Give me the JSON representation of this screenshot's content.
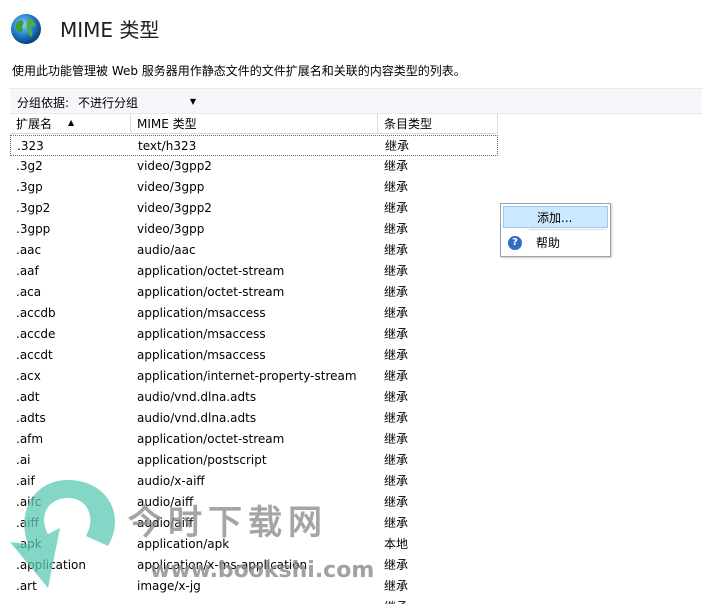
{
  "header": {
    "title": "MIME 类型",
    "description": "使用此功能管理被 Web 服务器用作静态文件的文件扩展名和关联的内容类型的列表。"
  },
  "toolbar": {
    "group_label": "分组依据:",
    "group_value": "不进行分组"
  },
  "columns": {
    "ext": "扩展名",
    "mime": "MIME 类型",
    "type": "条目类型"
  },
  "rows": [
    {
      "ext": ".323",
      "mime": "text/h323",
      "type": "继承"
    },
    {
      "ext": ".3g2",
      "mime": "video/3gpp2",
      "type": "继承"
    },
    {
      "ext": ".3gp",
      "mime": "video/3gpp",
      "type": "继承"
    },
    {
      "ext": ".3gp2",
      "mime": "video/3gpp2",
      "type": "继承"
    },
    {
      "ext": ".3gpp",
      "mime": "video/3gpp",
      "type": "继承"
    },
    {
      "ext": ".aac",
      "mime": "audio/aac",
      "type": "继承"
    },
    {
      "ext": ".aaf",
      "mime": "application/octet-stream",
      "type": "继承"
    },
    {
      "ext": ".aca",
      "mime": "application/octet-stream",
      "type": "继承"
    },
    {
      "ext": ".accdb",
      "mime": "application/msaccess",
      "type": "继承"
    },
    {
      "ext": ".accde",
      "mime": "application/msaccess",
      "type": "继承"
    },
    {
      "ext": ".accdt",
      "mime": "application/msaccess",
      "type": "继承"
    },
    {
      "ext": ".acx",
      "mime": "application/internet-property-stream",
      "type": "继承"
    },
    {
      "ext": ".adt",
      "mime": "audio/vnd.dlna.adts",
      "type": "继承"
    },
    {
      "ext": ".adts",
      "mime": "audio/vnd.dlna.adts",
      "type": "继承"
    },
    {
      "ext": ".afm",
      "mime": "application/octet-stream",
      "type": "继承"
    },
    {
      "ext": ".ai",
      "mime": "application/postscript",
      "type": "继承"
    },
    {
      "ext": ".aif",
      "mime": "audio/x-aiff",
      "type": "继承"
    },
    {
      "ext": ".aifc",
      "mime": "audio/aiff",
      "type": "继承"
    },
    {
      "ext": ".aiff",
      "mime": "audio/aiff",
      "type": "继承"
    },
    {
      "ext": ".apk",
      "mime": "application/apk",
      "type": "本地"
    },
    {
      "ext": ".application",
      "mime": "application/x-ms-application",
      "type": "继承"
    },
    {
      "ext": ".art",
      "mime": "image/x-jg",
      "type": "继承"
    },
    {
      "ext": "",
      "mime": "",
      "type": "继承"
    }
  ],
  "context_menu": {
    "add": "添加...",
    "help": "帮助"
  },
  "watermark": {
    "cn": "今时下载网",
    "url": "www.bookshi.com"
  },
  "icons": {
    "globe": "globe-icon",
    "help": "help-icon",
    "sort": "sort-ascending-icon",
    "dropdown": "chevron-down-icon"
  }
}
